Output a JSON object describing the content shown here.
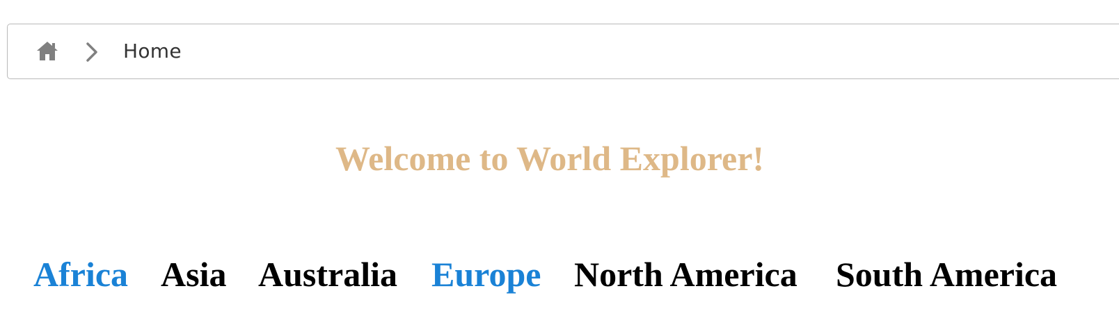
{
  "breadcrumb": {
    "home_icon": "home-icon",
    "separator_icon": "chevron-right-icon",
    "current_label": "Home"
  },
  "title": "Welcome to World Explorer!",
  "continents": [
    {
      "label": "Africa",
      "highlighted": true
    },
    {
      "label": "Asia",
      "highlighted": false
    },
    {
      "label": "Australia",
      "highlighted": false
    },
    {
      "label": "Europe",
      "highlighted": true
    },
    {
      "label": "North America",
      "highlighted": false
    },
    {
      "label": "South America",
      "highlighted": false
    }
  ],
  "colors": {
    "title": "#deb887",
    "link_highlight": "#1a82d6",
    "link_default": "#000000",
    "icon": "#808080"
  }
}
